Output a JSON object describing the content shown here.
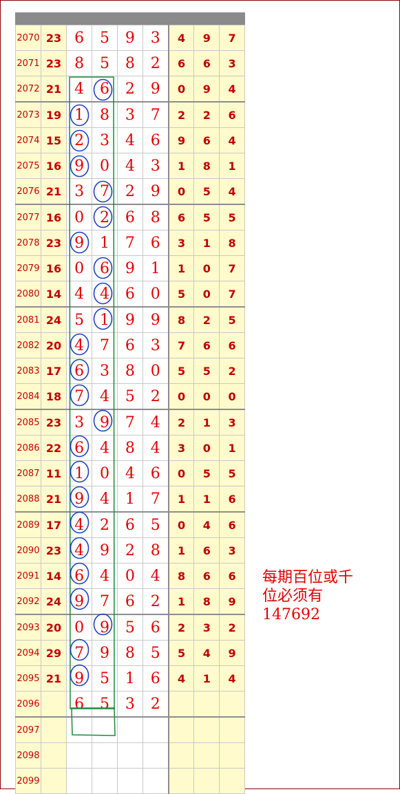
{
  "rows": [
    {
      "period": "2070",
      "sum": "23",
      "d": [
        "6",
        "5",
        "9",
        "3"
      ],
      "e": [
        "4",
        "9",
        "7"
      ]
    },
    {
      "period": "2071",
      "sum": "23",
      "d": [
        "8",
        "5",
        "8",
        "2"
      ],
      "e": [
        "6",
        "6",
        "3"
      ]
    },
    {
      "period": "2072",
      "sum": "21",
      "d": [
        "4",
        "6",
        "2",
        "9"
      ],
      "e": [
        "0",
        "9",
        "4"
      ]
    },
    {
      "period": "2073",
      "sum": "19",
      "d": [
        "1",
        "8",
        "3",
        "7"
      ],
      "e": [
        "2",
        "2",
        "6"
      ]
    },
    {
      "period": "2074",
      "sum": "15",
      "d": [
        "2",
        "3",
        "4",
        "6"
      ],
      "e": [
        "9",
        "6",
        "4"
      ]
    },
    {
      "period": "2075",
      "sum": "16",
      "d": [
        "9",
        "0",
        "4",
        "3"
      ],
      "e": [
        "1",
        "8",
        "1"
      ]
    },
    {
      "period": "2076",
      "sum": "21",
      "d": [
        "3",
        "7",
        "2",
        "9"
      ],
      "e": [
        "0",
        "5",
        "4"
      ]
    },
    {
      "period": "2077",
      "sum": "16",
      "d": [
        "0",
        "2",
        "6",
        "8"
      ],
      "e": [
        "6",
        "5",
        "5"
      ]
    },
    {
      "period": "2078",
      "sum": "23",
      "d": [
        "9",
        "1",
        "7",
        "6"
      ],
      "e": [
        "3",
        "1",
        "8"
      ]
    },
    {
      "period": "2079",
      "sum": "16",
      "d": [
        "0",
        "6",
        "9",
        "1"
      ],
      "e": [
        "1",
        "0",
        "7"
      ]
    },
    {
      "period": "2080",
      "sum": "14",
      "d": [
        "4",
        "4",
        "6",
        "0"
      ],
      "e": [
        "5",
        "0",
        "7"
      ]
    },
    {
      "period": "2081",
      "sum": "24",
      "d": [
        "5",
        "1",
        "9",
        "9"
      ],
      "e": [
        "8",
        "2",
        "5"
      ]
    },
    {
      "period": "2082",
      "sum": "20",
      "d": [
        "4",
        "7",
        "6",
        "3"
      ],
      "e": [
        "7",
        "6",
        "6"
      ]
    },
    {
      "period": "2083",
      "sum": "17",
      "d": [
        "6",
        "3",
        "8",
        "0"
      ],
      "e": [
        "5",
        "5",
        "2"
      ]
    },
    {
      "period": "2084",
      "sum": "18",
      "d": [
        "7",
        "4",
        "5",
        "2"
      ],
      "e": [
        "0",
        "0",
        "0"
      ]
    },
    {
      "period": "2085",
      "sum": "23",
      "d": [
        "3",
        "9",
        "7",
        "4"
      ],
      "e": [
        "2",
        "1",
        "3"
      ]
    },
    {
      "period": "2086",
      "sum": "22",
      "d": [
        "6",
        "4",
        "8",
        "4"
      ],
      "e": [
        "3",
        "0",
        "1"
      ]
    },
    {
      "period": "2087",
      "sum": "11",
      "d": [
        "1",
        "0",
        "4",
        "6"
      ],
      "e": [
        "0",
        "5",
        "5"
      ]
    },
    {
      "period": "2088",
      "sum": "21",
      "d": [
        "9",
        "4",
        "1",
        "7"
      ],
      "e": [
        "1",
        "1",
        "6"
      ]
    },
    {
      "period": "2089",
      "sum": "17",
      "d": [
        "4",
        "2",
        "6",
        "5"
      ],
      "e": [
        "0",
        "4",
        "6"
      ]
    },
    {
      "period": "2090",
      "sum": "23",
      "d": [
        "4",
        "9",
        "2",
        "8"
      ],
      "e": [
        "1",
        "6",
        "3"
      ]
    },
    {
      "period": "2091",
      "sum": "14",
      "d": [
        "6",
        "4",
        "0",
        "4"
      ],
      "e": [
        "8",
        "6",
        "6"
      ]
    },
    {
      "period": "2092",
      "sum": "24",
      "d": [
        "9",
        "7",
        "6",
        "2"
      ],
      "e": [
        "1",
        "8",
        "9"
      ]
    },
    {
      "period": "2093",
      "sum": "20",
      "d": [
        "0",
        "9",
        "5",
        "6"
      ],
      "e": [
        "2",
        "3",
        "2"
      ]
    },
    {
      "period": "2094",
      "sum": "29",
      "d": [
        "7",
        "9",
        "8",
        "5"
      ],
      "e": [
        "5",
        "4",
        "9"
      ]
    },
    {
      "period": "2095",
      "sum": "21",
      "d": [
        "9",
        "5",
        "1",
        "6"
      ],
      "e": [
        "4",
        "1",
        "4"
      ]
    },
    {
      "period": "2096",
      "sum": "",
      "d": [
        "6",
        "5",
        "3",
        "2"
      ],
      "e": [
        "",
        "",
        ""
      ]
    },
    {
      "period": "2097",
      "sum": "",
      "d": [
        "",
        "",
        "",
        ""
      ],
      "e": [
        "",
        "",
        ""
      ]
    },
    {
      "period": "2098",
      "sum": "",
      "d": [
        "",
        "",
        "",
        ""
      ],
      "e": [
        "",
        "",
        ""
      ]
    },
    {
      "period": "2099",
      "sum": "",
      "d": [
        "",
        "",
        "",
        ""
      ],
      "e": [
        "",
        "",
        ""
      ]
    }
  ],
  "circled": [
    {
      "row": 2,
      "col": 1
    },
    {
      "row": 3,
      "col": 0
    },
    {
      "row": 4,
      "col": 0
    },
    {
      "row": 5,
      "col": 0
    },
    {
      "row": 6,
      "col": 1
    },
    {
      "row": 7,
      "col": 1
    },
    {
      "row": 8,
      "col": 0
    },
    {
      "row": 9,
      "col": 1
    },
    {
      "row": 10,
      "col": 1
    },
    {
      "row": 11,
      "col": 1
    },
    {
      "row": 12,
      "col": 0
    },
    {
      "row": 13,
      "col": 0
    },
    {
      "row": 14,
      "col": 0
    },
    {
      "row": 15,
      "col": 1
    },
    {
      "row": 16,
      "col": 0
    },
    {
      "row": 17,
      "col": 0
    },
    {
      "row": 18,
      "col": 0
    },
    {
      "row": 19,
      "col": 0
    },
    {
      "row": 20,
      "col": 0
    },
    {
      "row": 21,
      "col": 0
    },
    {
      "row": 22,
      "col": 0
    },
    {
      "row": 23,
      "col": 1
    },
    {
      "row": 24,
      "col": 0
    },
    {
      "row": 25,
      "col": 0
    }
  ],
  "colors": {
    "digit": "#e00000",
    "circle": "#1f3fbf",
    "box": "#1a8a3a",
    "cell_bg": "#fffbcc"
  },
  "note": "每期百位或千\n位必须有\n147692"
}
